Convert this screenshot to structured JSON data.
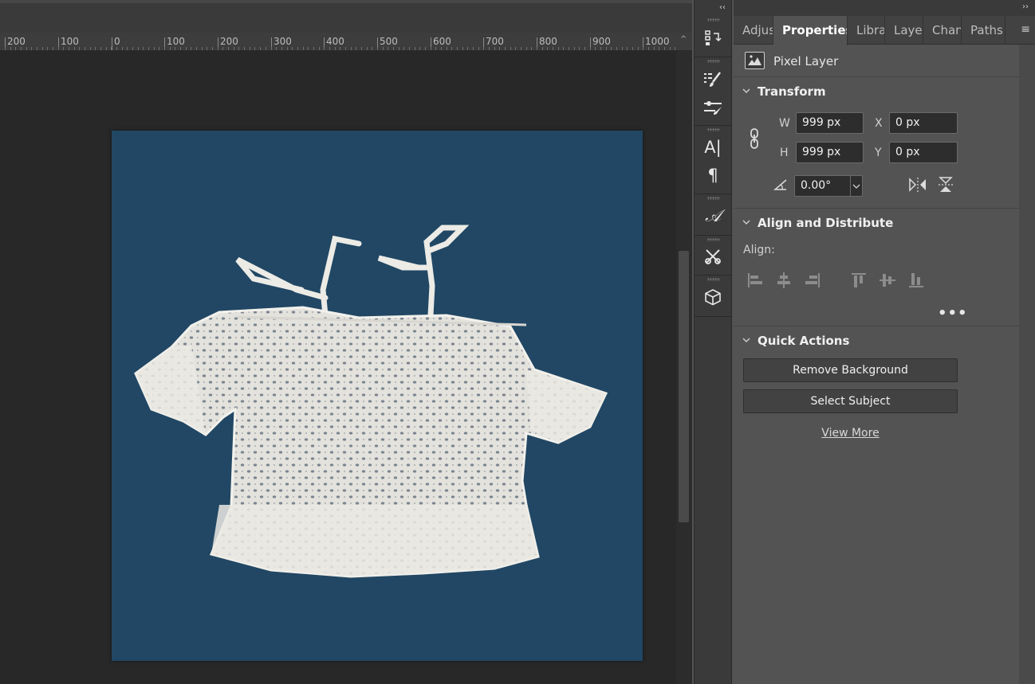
{
  "ruler": {
    "labels": [
      "200",
      "100",
      "0",
      "100",
      "200",
      "300",
      "400",
      "500",
      "600",
      "700",
      "800",
      "900",
      "1000"
    ],
    "corner_glyph": "^"
  },
  "tools": {
    "collapse_glyph": "‹‹",
    "paragraph_glyph": "¶",
    "char_glyph": "A|",
    "glyph_glyph": "𝒜"
  },
  "panel": {
    "expand_glyph": "››",
    "tabs": [
      {
        "label": "Adjus",
        "active": false
      },
      {
        "label": "Properties",
        "active": true
      },
      {
        "label": "Libra",
        "active": false
      },
      {
        "label": "Layer",
        "active": false
      },
      {
        "label": "Chan",
        "active": false
      },
      {
        "label": "Paths",
        "active": false
      }
    ],
    "menu_glyph": "≡",
    "layer_type": "Pixel Layer",
    "transform": {
      "title": "Transform",
      "w_label": "W",
      "w_value": "999 px",
      "h_label": "H",
      "h_value": "999 px",
      "x_label": "X",
      "x_value": "0 px",
      "y_label": "Y",
      "y_value": "0 px",
      "angle_value": "0.00°"
    },
    "align": {
      "title": "Align and Distribute",
      "align_label": "Align:",
      "more": "•••"
    },
    "quick_actions": {
      "title": "Quick Actions",
      "remove_bg": "Remove Background",
      "select_subject": "Select Subject",
      "view_more": "View More"
    }
  },
  "colors": {
    "canvas_bg": "#214764",
    "workspace": "#282828",
    "panel_bg": "#535353"
  }
}
